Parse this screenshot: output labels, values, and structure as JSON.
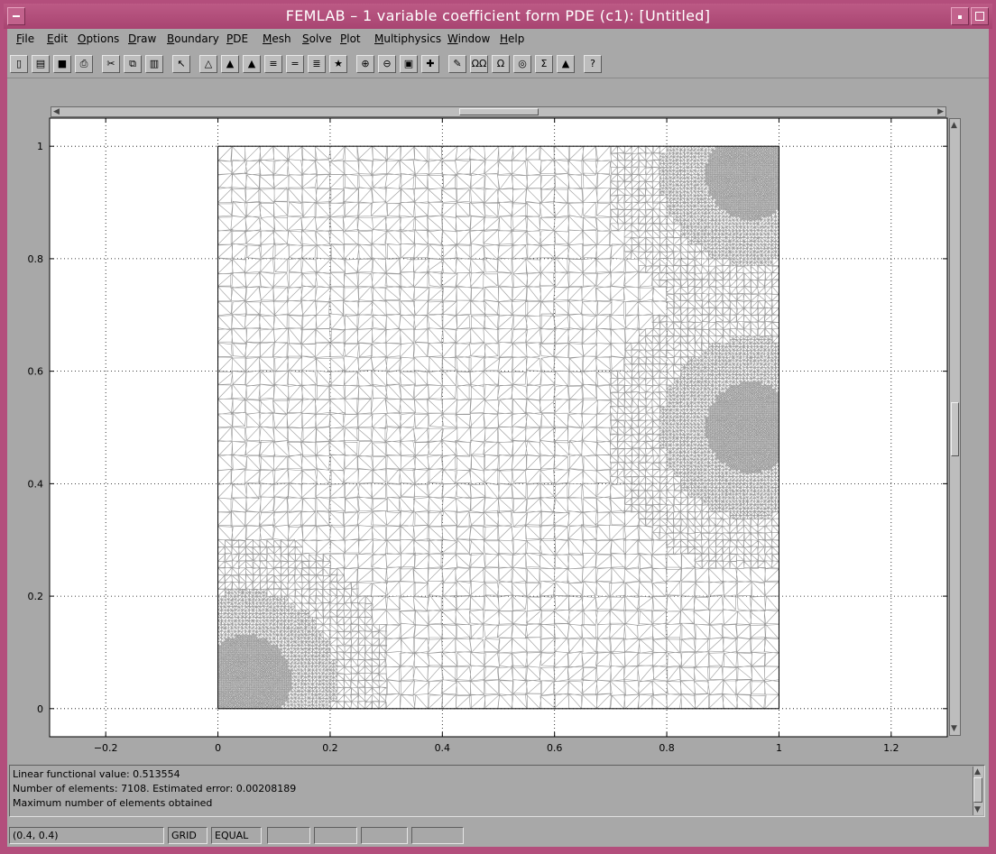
{
  "window": {
    "title": "FEMLAB – 1 variable coefficient form PDE (c1): [Untitled]",
    "accent_color": "#b34e7c"
  },
  "menu": [
    "File",
    "Edit",
    "Options",
    "Draw",
    "Boundary",
    "PDE",
    "Mesh",
    "Solve",
    "Plot",
    "Multiphysics",
    "Window",
    "Help"
  ],
  "toolbar": [
    {
      "name": "new-icon",
      "glyph": "▯"
    },
    {
      "name": "open-icon",
      "glyph": "▤"
    },
    {
      "name": "save-icon",
      "glyph": "■"
    },
    {
      "name": "print-icon",
      "glyph": "⎙"
    },
    {
      "name": "cut-icon",
      "glyph": "✂"
    },
    {
      "name": "copy-icon",
      "glyph": "⧉"
    },
    {
      "name": "paste-icon",
      "glyph": "▥"
    },
    {
      "name": "pointer-icon",
      "glyph": "↖"
    },
    {
      "name": "boundary-mode-icon",
      "glyph": "△"
    },
    {
      "name": "init-mesh-icon",
      "glyph": "▲"
    },
    {
      "name": "refine-mesh-icon",
      "glyph": "▲"
    },
    {
      "name": "jiggle-mesh-icon",
      "glyph": "≡"
    },
    {
      "name": "pde-spec-icon",
      "glyph": "="
    },
    {
      "name": "solve-params-icon",
      "glyph": "≣"
    },
    {
      "name": "solve-icon",
      "glyph": "★"
    },
    {
      "name": "zoom-in-icon",
      "glyph": "⊕"
    },
    {
      "name": "zoom-out-icon",
      "glyph": "⊖"
    },
    {
      "name": "zoom-window-icon",
      "glyph": "▣"
    },
    {
      "name": "zoom-extents-icon",
      "glyph": "✚"
    },
    {
      "name": "draw-mode-icon",
      "glyph": "✎"
    },
    {
      "name": "omega-omega-icon",
      "glyph": "ΩΩ"
    },
    {
      "name": "omega-icon",
      "glyph": "Ω"
    },
    {
      "name": "point-settings-icon",
      "glyph": "◎"
    },
    {
      "name": "sigma-icon",
      "glyph": "Σ"
    },
    {
      "name": "plot-icon",
      "glyph": "▲"
    },
    {
      "name": "help-icon",
      "glyph": "?"
    }
  ],
  "chart_data": {
    "type": "mesh",
    "title": "",
    "xlabel": "",
    "ylabel": "",
    "xlim": [
      -0.3,
      1.3
    ],
    "ylim": [
      -0.05,
      1.05
    ],
    "xticks": [
      -0.2,
      0,
      0.2,
      0.4,
      0.6,
      0.8,
      1,
      1.2
    ],
    "yticks": [
      0,
      0.2,
      0.4,
      0.6,
      0.8,
      1
    ],
    "xtick_labels": [
      "−0.2",
      "0",
      "0.2",
      "0.4",
      "0.6",
      "0.8",
      "1",
      "1.2"
    ],
    "ytick_labels": [
      "0",
      "0.2",
      "0.4",
      "0.6",
      "0.8",
      "1"
    ],
    "grid": true,
    "domain": {
      "x": [
        0,
        1
      ],
      "y": [
        0,
        1
      ]
    },
    "refinement_regions": [
      {
        "x": 0.05,
        "y": 0.05
      },
      {
        "x": 0.95,
        "y": 0.5
      },
      {
        "x": 0.95,
        "y": 0.95
      }
    ],
    "mesh_color": "#999999"
  },
  "messages": [
    "Linear functional value: 0.513554",
    "Number of elements: 7108. Estimated error: 0.00208189",
    "Maximum number of elements obtained"
  ],
  "status": {
    "coords": "(0.4, 0.4)",
    "grid": "GRID",
    "equal": "EQUAL"
  }
}
